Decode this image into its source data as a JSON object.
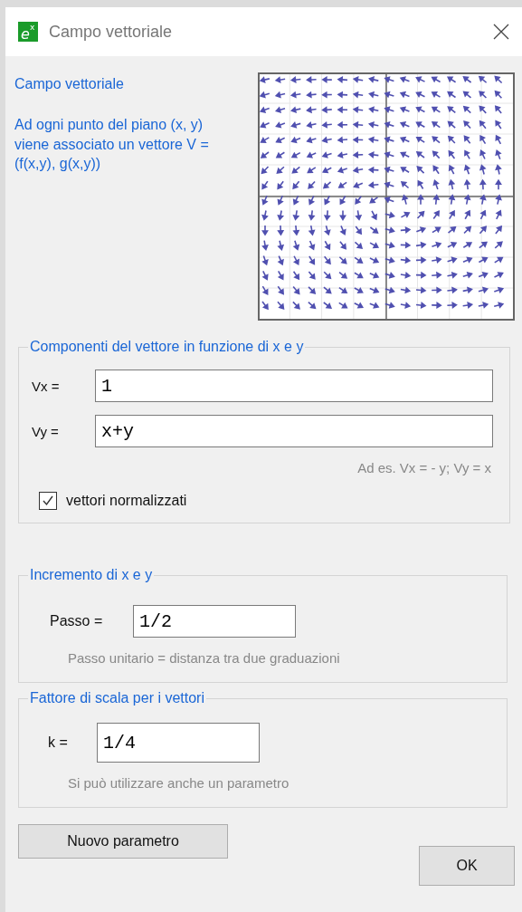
{
  "window": {
    "title": "Campo vettoriale",
    "logo": {
      "base": "e",
      "raised": "x"
    }
  },
  "intro": {
    "heading": "Campo vettoriale",
    "description": "Ad ogni punto del piano (x, y) viene associato un vettore V = (f(x,y), g(x,y))"
  },
  "components": {
    "legend": "Componenti del vettore in funzione di x e y",
    "fields": [
      {
        "label": "Vx =",
        "value": "1"
      },
      {
        "label": "Vy =",
        "value": "x+y"
      }
    ],
    "hint": "Ad es. Vx = - y; Vy = x",
    "normalize": {
      "label": "vettori normalizzati",
      "checked": true
    }
  },
  "increment": {
    "legend": "Incremento di x e y",
    "label": "Passo =",
    "value": "1/2",
    "hint": "Passo unitario = distanza tra due graduazioni"
  },
  "scale": {
    "legend": "Fattore di scala per i vettori",
    "label": "k =",
    "value": "1/4",
    "hint": "Si può utilizzare anche un parametro"
  },
  "buttons": {
    "new_parameter": "Nuovo parametro",
    "ok": "OK"
  }
}
